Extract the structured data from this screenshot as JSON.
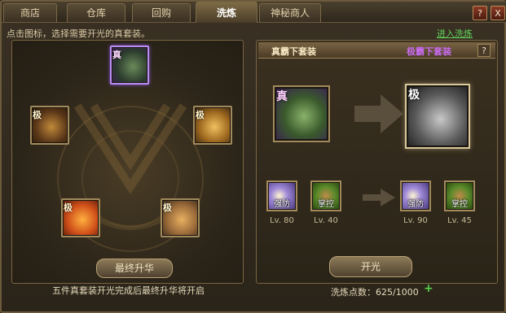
{
  "tabs": [
    {
      "label": "商店"
    },
    {
      "label": "仓库"
    },
    {
      "label": "回购"
    },
    {
      "label": "洗炼"
    },
    {
      "label": "神秘商人"
    }
  ],
  "window_buttons": {
    "help": "?",
    "close": "X"
  },
  "hint": "点击图标，选择需要开光的真套装。",
  "enter_link": "进入洗炼",
  "slots": [
    {
      "tag": "真"
    },
    {
      "tag": "极"
    },
    {
      "tag": "极"
    },
    {
      "tag": "极"
    },
    {
      "tag": "极"
    }
  ],
  "right": {
    "title_left": "真霸下套装",
    "title_right": "极霸下套装",
    "help": "?",
    "from_tag": "真",
    "to_tag": "极",
    "skills_from": [
      {
        "name": "强防",
        "level": "Lv. 80"
      },
      {
        "name": "掌控",
        "level": "Lv. 40"
      }
    ],
    "skills_to": [
      {
        "name": "强防",
        "level": "Lv. 90"
      },
      {
        "name": "掌控",
        "level": "Lv. 45"
      }
    ]
  },
  "left_button": "最终升华",
  "left_note": "五件真套装开光完成后最终升华将开启",
  "right_button": "开光",
  "points": {
    "label": "洗炼点数：",
    "value": "625/1000"
  },
  "colors": {
    "accent_purple": "#c96cf0",
    "link_green": "#61d25a",
    "frame": "#a28a5c"
  }
}
